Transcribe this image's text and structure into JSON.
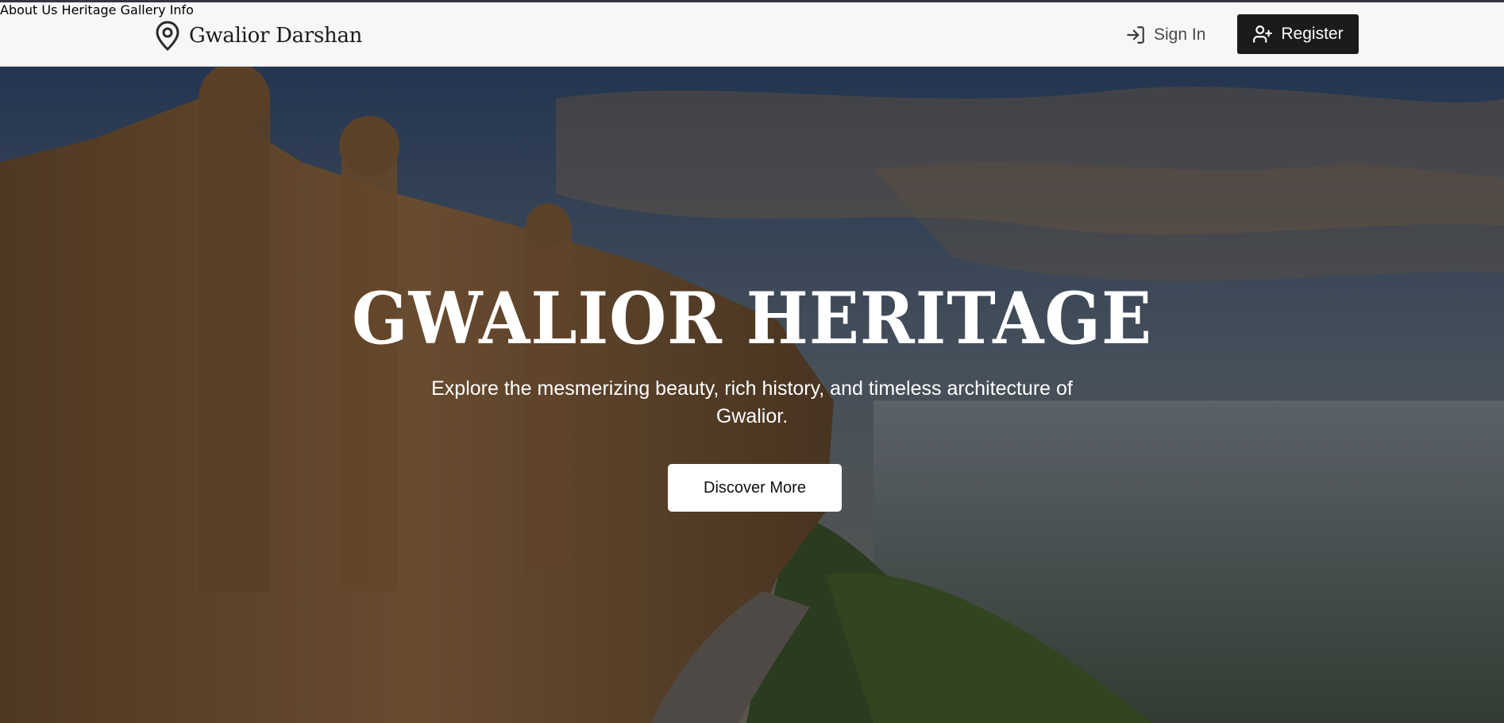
{
  "brand": {
    "name": "Gwalior Darshan",
    "icon": "map-pin-icon"
  },
  "nav": {
    "items": [
      {
        "label": "About Us"
      },
      {
        "label": "Heritage"
      },
      {
        "label": "Gallery"
      },
      {
        "label": "Info"
      }
    ],
    "signin": {
      "label": "Sign In",
      "icon": "sign-in-icon"
    },
    "register": {
      "label": "Register",
      "icon": "user-plus-icon"
    }
  },
  "hero": {
    "title": "GWALIOR HERITAGE",
    "subtitle": "Explore the mesmerizing beauty, rich history, and timeless architecture of Gwalior.",
    "cta_label": "Discover More",
    "background": "gwalior-fort-photo"
  },
  "colors": {
    "navbar_bg": "#f7f7f8",
    "register_bg": "#1c1b1a",
    "text_dark": "#1c1c1c",
    "nav_text": "#4a4a4a"
  }
}
